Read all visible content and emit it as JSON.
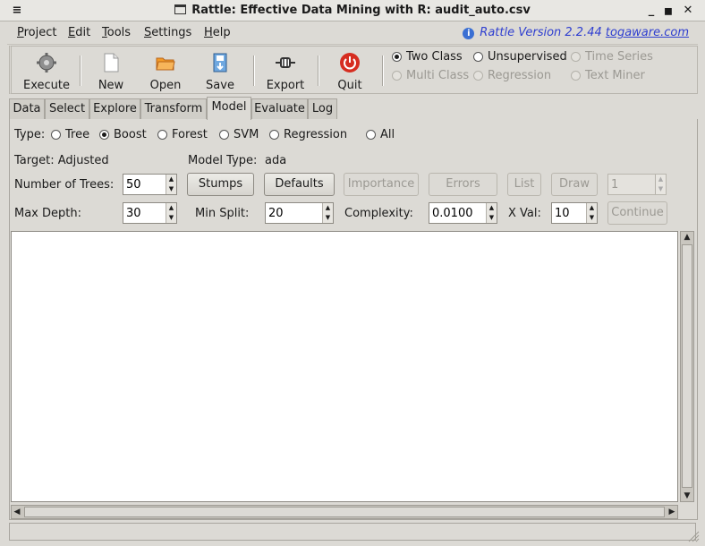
{
  "window": {
    "title": "Rattle: Effective Data Mining with R: audit_auto.csv"
  },
  "menubar": {
    "items": [
      {
        "label": "Project",
        "ul": "P",
        "rest": "roject"
      },
      {
        "label": "Edit",
        "ul": "E",
        "rest": "dit"
      },
      {
        "label": "Tools",
        "ul": "T",
        "rest": "ools"
      },
      {
        "label": "Settings",
        "ul": "S",
        "rest": "ettings"
      },
      {
        "label": "Help",
        "ul": "H",
        "rest": "elp"
      }
    ],
    "version_text": "Rattle Version 2.2.44",
    "version_link": "togaware.com"
  },
  "toolbar": {
    "execute": "Execute",
    "new": "New",
    "open": "Open",
    "save": "Save",
    "export": "Export",
    "quit": "Quit"
  },
  "modes": {
    "two_class": "Two Class",
    "unsupervised": "Unsupervised",
    "time_series": "Time Series",
    "multi_class": "Multi Class",
    "regression": "Regression",
    "text_miner": "Text Miner",
    "selected": "Two Class"
  },
  "tabs": [
    "Data",
    "Select",
    "Explore",
    "Transform",
    "Model",
    "Evaluate",
    "Log"
  ],
  "active_tab": "Model",
  "model": {
    "type_label": "Type:",
    "types": [
      "Tree",
      "Boost",
      "Forest",
      "SVM",
      "Regression",
      "All"
    ],
    "selected_type": "Boost",
    "target_label": "Target: Adjusted",
    "model_type_label": "Model Type:",
    "model_type_value": "ada",
    "num_trees_label": "Number of Trees:",
    "num_trees_value": "50",
    "stumps": "Stumps",
    "defaults": "Defaults",
    "importance": "Importance",
    "errors": "Errors",
    "list": "List",
    "draw": "Draw",
    "draw_value": "1",
    "max_depth_label": "Max Depth:",
    "max_depth_value": "30",
    "min_split_label": "Min Split:",
    "min_split_value": "20",
    "complexity_label": "Complexity:",
    "complexity_value": "0.0100",
    "xval_label": "X Val:",
    "xval_value": "10",
    "continue": "Continue"
  },
  "colors": {
    "link_blue": "#2f3fd0",
    "quit_red": "#d62d20",
    "open_orange": "#f39a27"
  }
}
